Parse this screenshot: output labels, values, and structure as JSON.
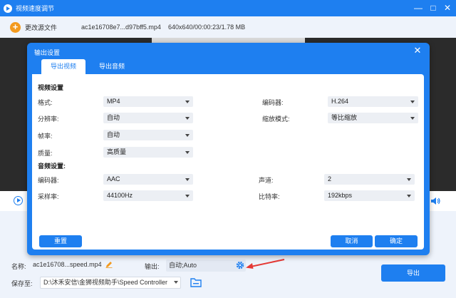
{
  "window": {
    "title": "视频速度调节"
  },
  "topbar": {
    "change_source": "更改源文件",
    "filename": "ac1e16708e7...d97bff5.mp4",
    "fileinfo": "640x640/00:00:23/1.78 MB"
  },
  "bottom": {
    "name_label": "名称:",
    "name_value": "ac1e16708...speed.mp4",
    "output_label": "输出:",
    "output_value": "自动;Auto",
    "save_label": "保存至:",
    "save_path": "D:\\沐禾安信\\金狮视频助手\\Speed Controller",
    "export_button": "导出"
  },
  "dialog": {
    "title": "输出设置",
    "tabs": [
      "导出视频",
      "导出音频"
    ],
    "video_section": "视频设置",
    "audio_section": "音频设置:",
    "video": {
      "format_label": "格式:",
      "format_value": "MP4",
      "resolution_label": "分辨率:",
      "resolution_value": "自动",
      "framerate_label": "帧率:",
      "framerate_value": "自动",
      "quality_label": "质量:",
      "quality_value": "高质量",
      "encoder_label": "编码器:",
      "encoder_value": "H.264",
      "zoom_label": "缩放模式:",
      "zoom_value": "等比缩放"
    },
    "audio": {
      "encoder_label": "编码器:",
      "encoder_value": "AAC",
      "samplerate_label": "采样率:",
      "samplerate_value": "44100Hz",
      "channel_label": "声道:",
      "channel_value": "2",
      "bitrate_label": "比特率:",
      "bitrate_value": "192kbps"
    },
    "reset_button": "重置",
    "cancel_button": "取消",
    "ok_button": "确定"
  },
  "colors": {
    "accent": "#1e7ff0",
    "plus": "#f39a1e",
    "annotation": "#e53935"
  }
}
